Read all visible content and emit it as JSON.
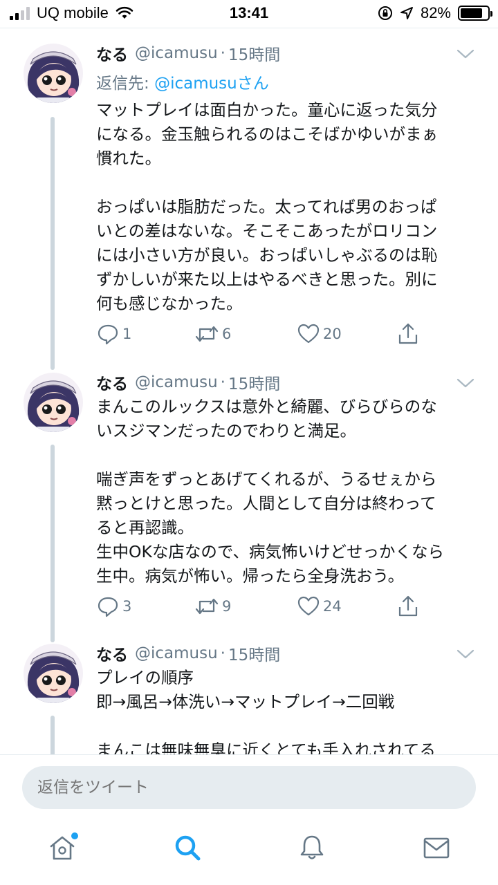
{
  "status_bar": {
    "carrier": "UQ mobile",
    "time": "13:41",
    "battery_percent": "82%",
    "battery_level": 0.82,
    "icons": [
      "signal-icon",
      "wifi-icon",
      "orientation-lock-icon",
      "location-icon",
      "battery-icon"
    ]
  },
  "tweets": [
    {
      "name": "なる",
      "handle": "@icamusu",
      "separator": "·",
      "time": "15時間",
      "reply_to_prefix": "返信先: ",
      "reply_to_link": "@icamusuさん",
      "text": "マットプレイは面白かった。童心に返った気分\nになる。金玉触られるのはこそばかゆいがまぁ\n慣れた。\n\nおっぱいは脂肪だった。太ってれば男のおっぱ\nいとの差はないな。そこそこあったがロリコン\nには小さい方が良い。おっぱいしゃぶるのは恥\nずかしいが来た以上はやるべきと思った。別に\n何も感じなかった。",
      "replies": "1",
      "retweets": "6",
      "likes": "20"
    },
    {
      "name": "なる",
      "handle": "@icamusu",
      "separator": "·",
      "time": "15時間",
      "text": "まんこのルックスは意外と綺麗、びらびらのな\nいスジマンだったのでわりと満足。\n\n喘ぎ声をずっとあげてくれるが、うるせぇから\n黙っとけと思った。人間として自分は終わって\nると再認識。\n生中OKな店なので、病気怖いけどせっかくなら\n生中。病気が怖い。帰ったら全身洗おう。",
      "replies": "3",
      "retweets": "9",
      "likes": "24"
    },
    {
      "name": "なる",
      "handle": "@icamusu",
      "separator": "·",
      "time": "15時間",
      "text": "プレイの順序\n即→風呂→体洗い→マットプレイ→二回戦\n\nまんこは無味無臭に近くとても手入れされてる"
    }
  ],
  "reply_box": {
    "placeholder": "返信をツイート"
  },
  "tab_bar": {
    "items": [
      "home-icon",
      "search-icon",
      "notifications-icon",
      "messages-icon"
    ],
    "active": "search-icon"
  },
  "colors": {
    "accent": "#1da1f2",
    "secondary_text": "#657786",
    "thread_line": "#ccd6dd",
    "divider": "#e6ecf0"
  }
}
